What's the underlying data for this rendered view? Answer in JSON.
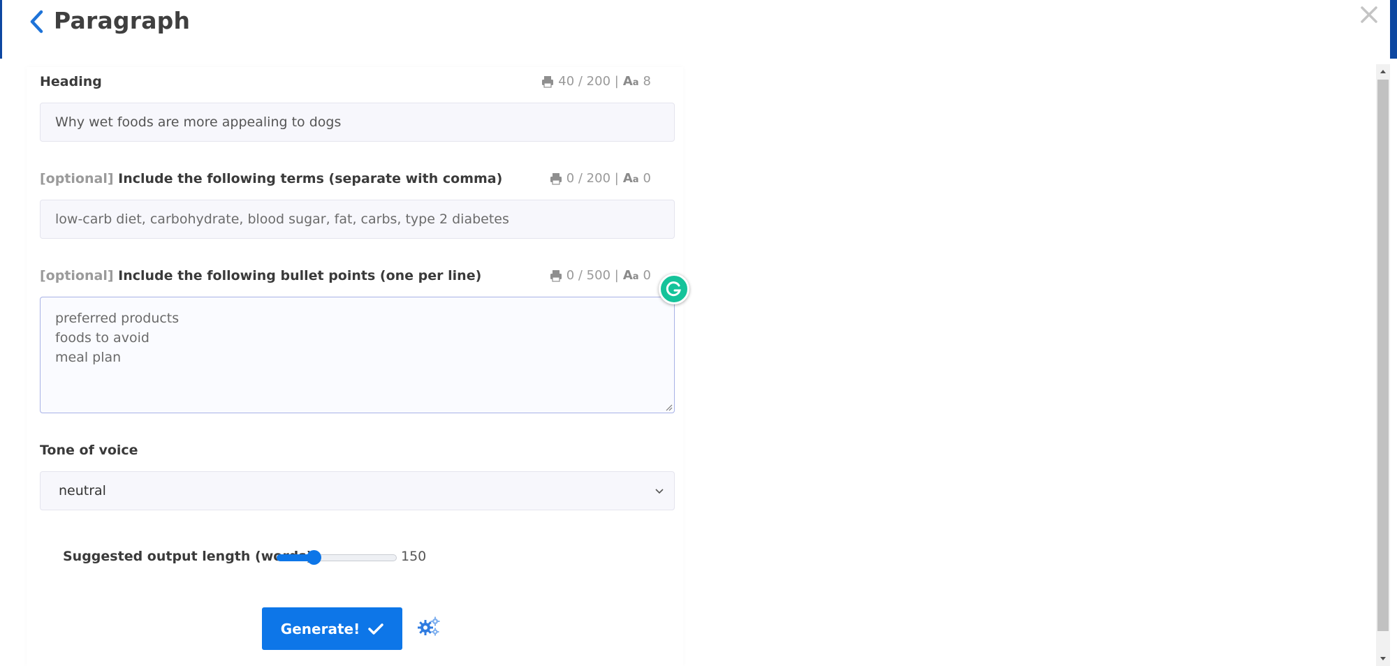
{
  "header": {
    "title": "Paragraph"
  },
  "fields": {
    "heading": {
      "label": "Heading",
      "counter_chars": "40 / 200 |",
      "counter_words": "8",
      "value": "Why wet foods are more appealing to dogs"
    },
    "terms": {
      "optional_tag": "[optional]",
      "label": "Include the following terms (separate with comma)",
      "counter_chars": "0 / 200 |",
      "counter_words": "0",
      "placeholder": "low-carb diet, carbohydrate, blood sugar, fat, carbs, type 2 diabetes"
    },
    "bullets": {
      "optional_tag": "[optional]",
      "label": "Include the following bullet points (one per line)",
      "counter_chars": "0 / 500 |",
      "counter_words": "0",
      "placeholder_lines": [
        "preferred products",
        "foods to avoid",
        "meal plan"
      ]
    }
  },
  "tone": {
    "label": "Tone of voice",
    "selected": "neutral"
  },
  "length": {
    "label": "Suggested output length (words):",
    "value": "150",
    "fraction": 0.31
  },
  "actions": {
    "generate_label": "Generate!"
  },
  "colors": {
    "accent": "#0d76e8",
    "grammarly": "#15c39a",
    "header_bar": "#0d47a1"
  },
  "icons": {
    "back": "chevron-left-icon",
    "close": "close-icon",
    "counter": "printer-icon",
    "words": "font-size-icon",
    "check": "check-icon",
    "settings": "gears-icon",
    "grammarly": "grammarly-icon"
  }
}
